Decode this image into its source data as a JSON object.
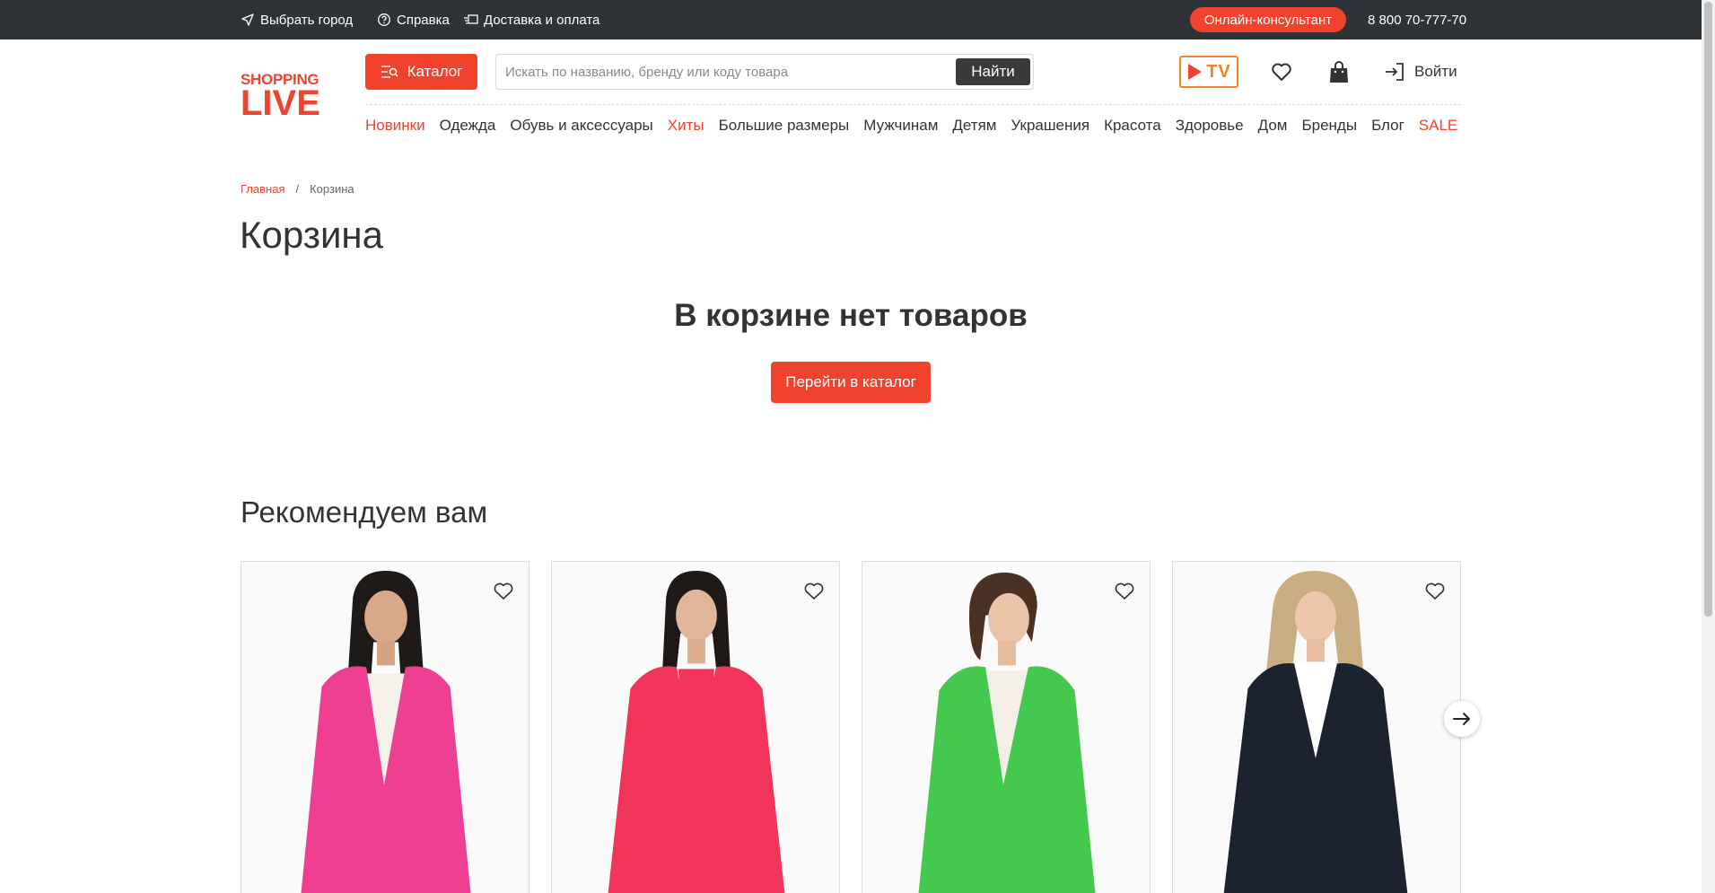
{
  "topbar": {
    "city_label": "Выбрать город",
    "help_label": "Справка",
    "delivery_label": "Доставка и оплата",
    "consultant_label": "Онлайн-консультант",
    "phone": "8 800 70-777-70"
  },
  "header": {
    "logo_top": "SHOPPING",
    "logo_bottom": "LIVE",
    "catalog_label": "Каталог",
    "search_placeholder": "Искать по названию, бренду или коду товара",
    "search_button": "Найти",
    "tv_label": "TV",
    "login_label": "Войти"
  },
  "nav": {
    "items": [
      {
        "label": "Новинки",
        "accent": true
      },
      {
        "label": "Одежда",
        "accent": false
      },
      {
        "label": "Обувь и аксессуары",
        "accent": false
      },
      {
        "label": "Хиты",
        "accent": true
      },
      {
        "label": "Большие размеры",
        "accent": false
      },
      {
        "label": "Мужчинам",
        "accent": false
      },
      {
        "label": "Детям",
        "accent": false
      },
      {
        "label": "Украшения",
        "accent": false
      },
      {
        "label": "Красота",
        "accent": false
      },
      {
        "label": "Здоровье",
        "accent": false
      },
      {
        "label": "Дом",
        "accent": false
      },
      {
        "label": "Бренды",
        "accent": false
      },
      {
        "label": "Блог",
        "accent": false
      },
      {
        "label": "SALE",
        "accent": true
      }
    ]
  },
  "breadcrumb": {
    "home": "Главная",
    "separator": "/",
    "current": "Корзина"
  },
  "page": {
    "title": "Корзина",
    "empty_message": "В корзине нет товаров",
    "goto_catalog": "Перейти в каталог"
  },
  "recommendations": {
    "title": "Рекомендуем вам",
    "products": [
      {
        "jacket_color": "#ef3f93",
        "hair_color": "#1e1a18",
        "shirt_color": "#f4f0ea"
      },
      {
        "jacket_color": "#f0345a",
        "hair_color": "#1e1816",
        "shirt_color": "#f0345a"
      },
      {
        "jacket_color": "#44c94e",
        "hair_color": "#4a3124",
        "shirt_color": "#f3efe6"
      },
      {
        "jacket_color": "#1d2230",
        "hair_color": "#c9ae84",
        "shirt_color": "#ffffff"
      }
    ]
  },
  "colors": {
    "accent": "#f0422c",
    "topbar_bg": "#2e3338",
    "tv_orange": "#f5811f"
  }
}
